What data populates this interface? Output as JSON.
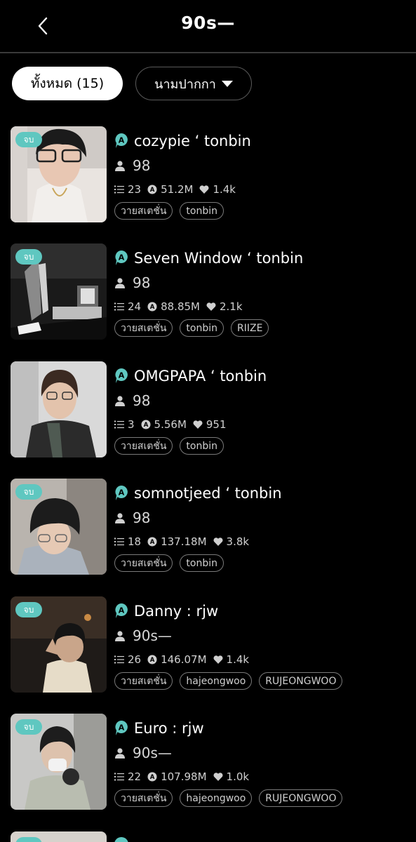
{
  "header": {
    "title": "90s—",
    "back_icon": "chevron-left-icon"
  },
  "filters": {
    "all_label": "ทั้งหมด (15)",
    "sort_label": "นามปากกา"
  },
  "colors": {
    "background": "#000000",
    "badge": "#5fc7c0",
    "chip_active": "#ffffff"
  },
  "stories": [
    {
      "badge": "จบ",
      "title": "cozypie ʻ tonbin",
      "author": "98",
      "chapters": "23",
      "views": "51.2M",
      "likes": "1.4k",
      "tags": [
        "วายสเตชั่น",
        "tonbin"
      ]
    },
    {
      "badge": "จบ",
      "title": "Seven Window ʻ tonbin",
      "author": "98",
      "chapters": "24",
      "views": "88.85M",
      "likes": "2.1k",
      "tags": [
        "วายสเตชั่น",
        "tonbin",
        "RIIZE"
      ]
    },
    {
      "badge": "",
      "title": "OMGPAPA ʻ tonbin",
      "author": "98",
      "chapters": "3",
      "views": "5.56M",
      "likes": "951",
      "tags": [
        "วายสเตชั่น",
        "tonbin"
      ]
    },
    {
      "badge": "จบ",
      "title": "somnotjeed ʻ tonbin",
      "author": "98",
      "chapters": "18",
      "views": "137.18M",
      "likes": "3.8k",
      "tags": [
        "วายสเตชั่น",
        "tonbin"
      ]
    },
    {
      "badge": "จบ",
      "title": "Danny : rjw",
      "author": "90s—",
      "chapters": "26",
      "views": "146.07M",
      "likes": "1.4k",
      "tags": [
        "วายสเตชั่น",
        "hajeongwoo",
        "RUJEONGWOO"
      ]
    },
    {
      "badge": "จบ",
      "title": "Euro : rjw",
      "author": "90s—",
      "chapters": "22",
      "views": "107.98M",
      "likes": "1.0k",
      "tags": [
        "วายสเตชั่น",
        "hajeongwoo",
        "RUJEONGWOO"
      ]
    }
  ]
}
